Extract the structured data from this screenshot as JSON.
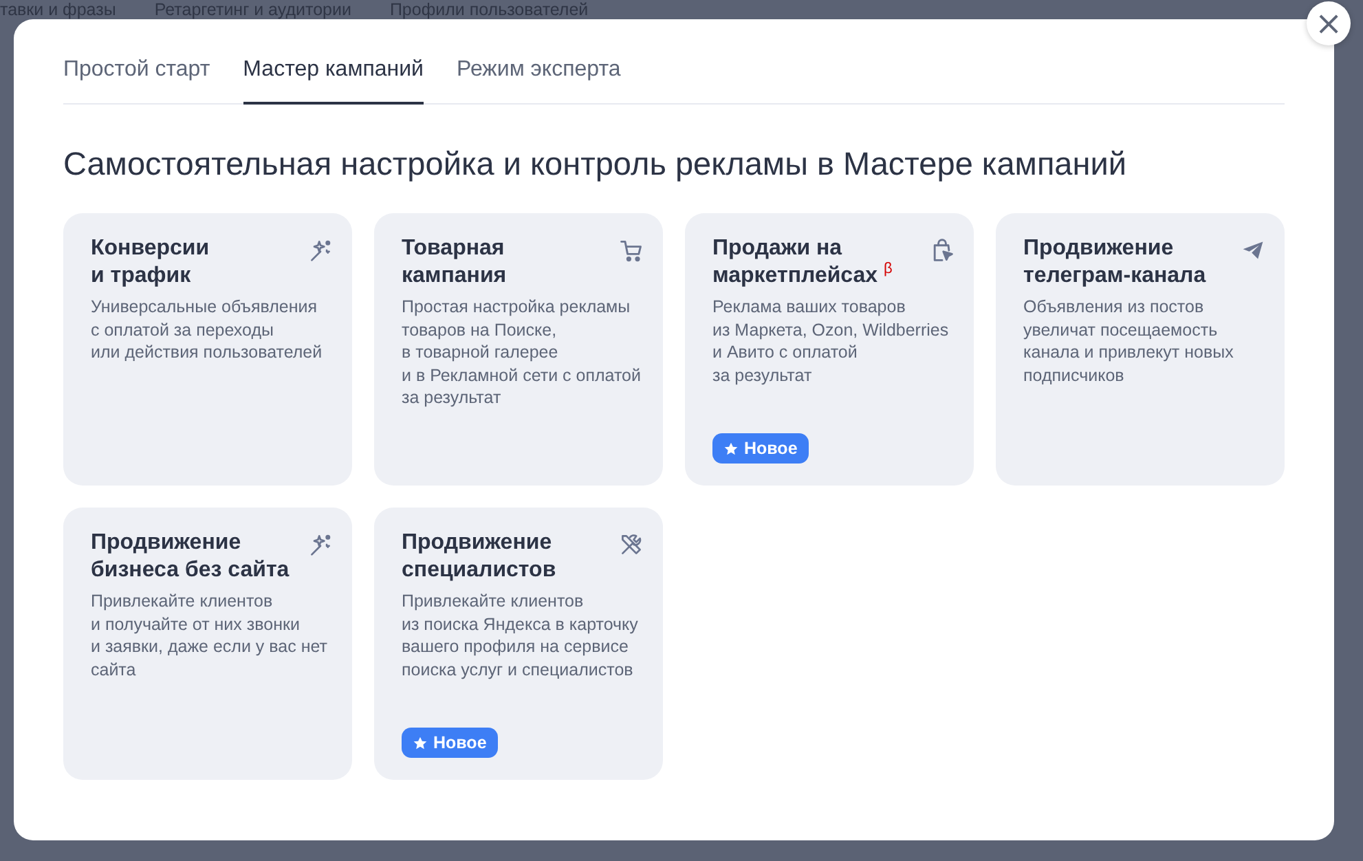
{
  "background_nav": [
    "тавки и фразы",
    "Ретаргетинг и аудитории",
    "Профили пользователей"
  ],
  "tabs": [
    {
      "label": "Простой старт",
      "selected": false
    },
    {
      "label": "Мастер кампаний",
      "selected": true
    },
    {
      "label": "Режим эксперта",
      "selected": false
    }
  ],
  "heading": "Самостоятельная настройка и контроль рекламы в Мастере кампаний",
  "cards": [
    {
      "title": "Конверсии\nи трафик",
      "kind": "wand",
      "description": "Универсальные объявления\nс оплатой за переходы\nили действия пользователей"
    },
    {
      "title": "Товарная\nкампания",
      "kind": "cart",
      "description": "Простая настройка рекламы\nтоваров на Поиске,\nв товарной галерее\nи в Рекламной сети с оплатой\nза результат"
    },
    {
      "title": "Продажи на\nмаркетплейсах $^{β}$",
      "kind": "bag",
      "description": "Реклама ваших товаров\nиз Маркета, Ozon, Wildberries\nи Авито с оплатой\nза результат",
      "badge": "Новое"
    },
    {
      "title": "Продвижение\nтелеграм-канала",
      "kind": "plane",
      "description": "Объявления из постов\nувеличат посещаемость\nканала и привлекут новых\nподписчиков"
    },
    {
      "title": "Продвижение\nбизнеса без сайта",
      "kind": "wand",
      "description": "Привлекайте клиентов\nи получайте от них звонки\nи заявки, даже если у вас нет\nсайта"
    },
    {
      "title": "Продвижение\nспециалистов",
      "kind": "tools",
      "description": "Привлекайте клиентов\nиз поиска Яндекса в карточку\nвашего профиля на сервисе\nпоиска услуг и специалистов",
      "badge": "Новое"
    }
  ],
  "close_button": "×"
}
